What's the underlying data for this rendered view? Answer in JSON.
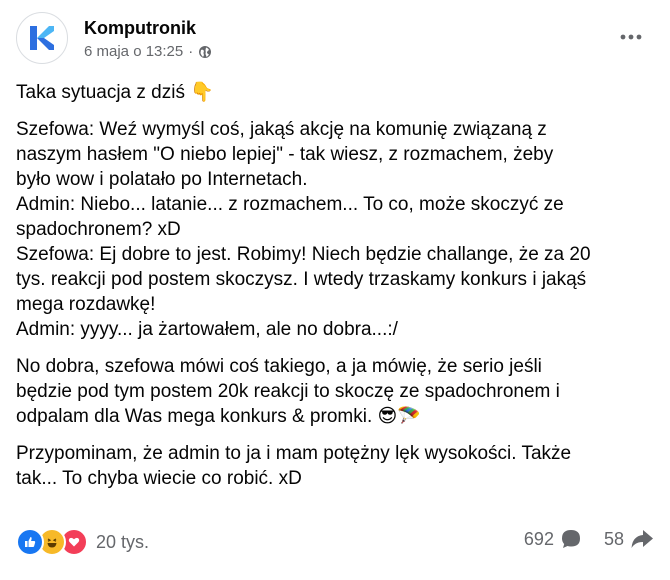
{
  "post": {
    "page_name": "Komputronik",
    "date": "6 maja o 13:25",
    "separator": "·",
    "paragraphs": [
      [
        "Taka sytuacja z dziś 👇"
      ],
      [
        "Szefowa: Weź wymyśl coś, jakąś akcję na komunię związaną z",
        "naszym hasłem \"O niebo lepiej\" -  tak wiesz, z rozmachem, żeby",
        "było wow i polatało po Internetach.",
        "Admin: Niebo... latanie... z rozmachem... To co, może skoczyć ze",
        "spadochronem? xD",
        "Szefowa: Ej dobre to jest. Robimy! Niech będzie challange, że za 20",
        "tys. reakcji pod postem skoczysz. I wtedy trzaskamy konkurs i jakąś",
        "mega rozdawkę!",
        "Admin: yyyy... ja żartowałem, ale no dobra...:/"
      ],
      [
        "No dobra, szefowa mówi coś takiego, a ja mówię, że serio jeśli",
        "będzie pod tym postem 20k reakcji to skoczę ze spadochronem i",
        "odpalam dla Was mega konkurs & promki. 😎🪂"
      ],
      [
        "Przypominam, że admin to ja i mam potężny lęk wysokości. Także",
        "tak... To chyba wiecie co robić.  xD"
      ]
    ]
  },
  "footer": {
    "reaction_count": "20 tys.",
    "comment_count": "692",
    "share_count": "58",
    "reaction_icons": [
      "like-icon",
      "haha-icon",
      "love-icon"
    ]
  },
  "colors": {
    "brand_blue": "#1877f2",
    "secondary_text": "#65676b",
    "logo_blue": "#2d6fe0"
  }
}
